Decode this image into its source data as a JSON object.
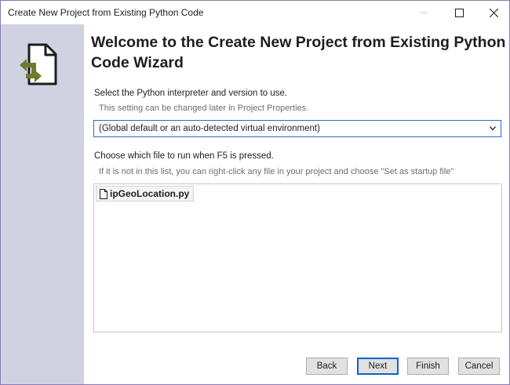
{
  "window": {
    "title": "Create New Project from Existing Python Code"
  },
  "wizard": {
    "heading": "Welcome to the Create New Project from Existing Python Code Wizard"
  },
  "interpreter": {
    "label": "Select the Python interpreter and version to use.",
    "hint": "This setting can be changed later in Project Properties.",
    "selected": "(Global default or an auto-detected virtual environment)"
  },
  "startup": {
    "label": "Choose which file to run when F5 is pressed.",
    "hint": "If it is not in this list, you can right-click any file in your project and choose \"Set as startup file\"",
    "files": [
      "ipGeoLocation.py"
    ]
  },
  "buttons": {
    "back": "Back",
    "next": "Next",
    "finish": "Finish",
    "cancel": "Cancel"
  },
  "colors": {
    "sidebar": "#d0d2e2",
    "accent": "#1f6fc7",
    "window_border": "#8a7bb8",
    "icon_green": "#6f7a2e"
  }
}
